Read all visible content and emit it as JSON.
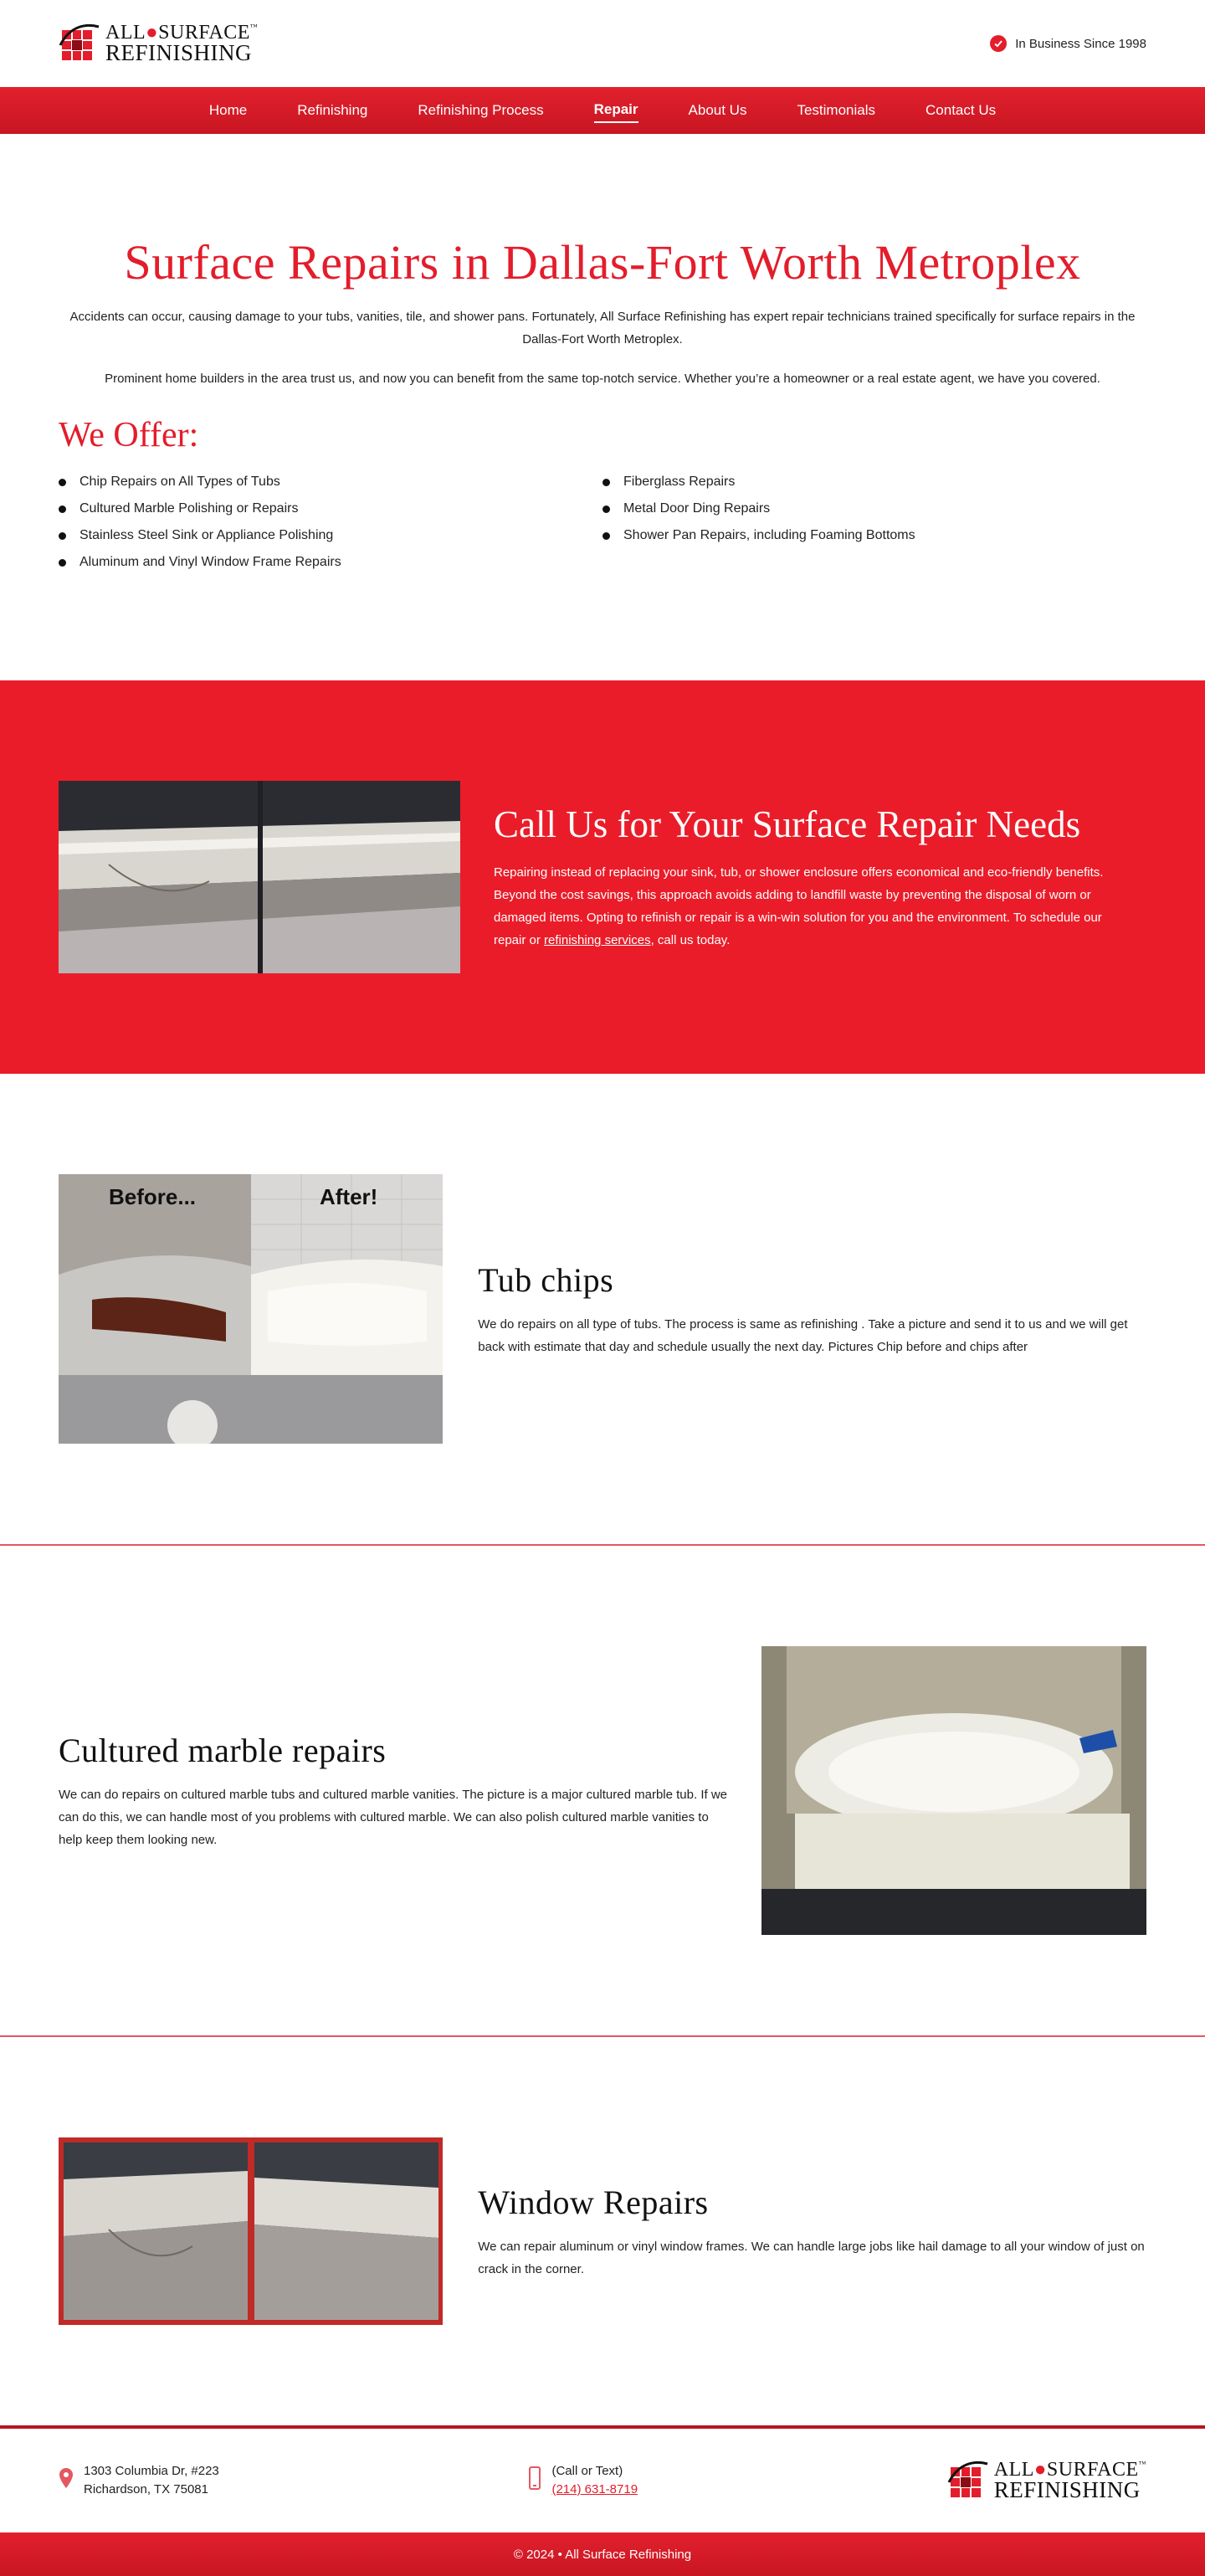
{
  "brand": {
    "logo_line1": "ALL",
    "logo_line1b": "SURFACE",
    "logo_line2": "REFINISHING",
    "tm": "™",
    "primary_color": "#e31d2b"
  },
  "header": {
    "since_icon": "check-circle-icon",
    "since_text": "In Business Since 1998"
  },
  "nav": {
    "items": [
      "Home",
      "Refinishing",
      "Refinishing Process",
      "Repair",
      "About Us",
      "Testimonials",
      "Contact Us"
    ],
    "active": "Repair"
  },
  "intro": {
    "title": "Surface Repairs in Dallas-Fort Worth Metroplex",
    "p1": "Accidents can occur, causing damage to your tubs, vanities, tile, and shower pans. Fortunately, All Surface Refinishing has expert repair technicians trained specifically for surface repairs in the Dallas-Fort Worth Metroplex.",
    "p2": "Prominent home builders in the area trust us, and now you can benefit from the same top-notch service. Whether you’re a homeowner or a real estate agent, we have you covered."
  },
  "offer": {
    "title": "We Offer:",
    "col1": [
      "Chip Repairs on All Types of Tubs",
      "Cultured Marble Polishing or Repairs",
      "Stainless Steel Sink or Appliance Polishing",
      "Aluminum and Vinyl Window Frame Repairs"
    ],
    "col2": [
      "Fiberglass Repairs",
      "Metal Door Ding Repairs",
      "Shower Pan Repairs, including Foaming Bottoms"
    ]
  },
  "cta": {
    "title": "Call Us for Your Surface Repair Needs",
    "text_before": "Repairing instead of replacing your sink, tub, or shower enclosure offers economical and eco-friendly benefits. Beyond the cost savings, this approach avoids adding to landfill waste by preventing the disposal of worn or damaged items. Opting to refinish or repair is a win-win solution for you and the environment. To schedule our repair or ",
    "link": "refinishing services",
    "text_after": ", call us today."
  },
  "sections": {
    "tub": {
      "title": "Tub chips",
      "text": "We do repairs on all type of tubs. The process is same as refinishing . Take a picture and send it to us and we will get back with estimate that day and schedule usually the next day. Pictures Chip before and chips after",
      "before_label": "Before...",
      "after_label": "After!"
    },
    "marble": {
      "title": "Cultured marble repairs",
      "text": "We can do repairs on cultured marble tubs and cultured marble vanities. The picture is a major cultured marble tub. If we can do this, we can handle most of you problems with cultured marble. We can also polish cultured marble vanities to help keep them looking new."
    },
    "window": {
      "title": "Window Repairs",
      "text": "We can repair aluminum or vinyl window frames. We can handle large jobs like hail damage to all your window of just on crack in the corner."
    }
  },
  "footer": {
    "address_icon": "map-pin-icon",
    "address_line1": "1303 Columbia Dr, #223",
    "address_line2": "Richardson, TX 75081",
    "phone_icon": "phone-icon",
    "phone_label": "(Call or Text)",
    "phone": "(214) 631-8719",
    "copyright": "© 2024 • All Surface Refinishing"
  }
}
